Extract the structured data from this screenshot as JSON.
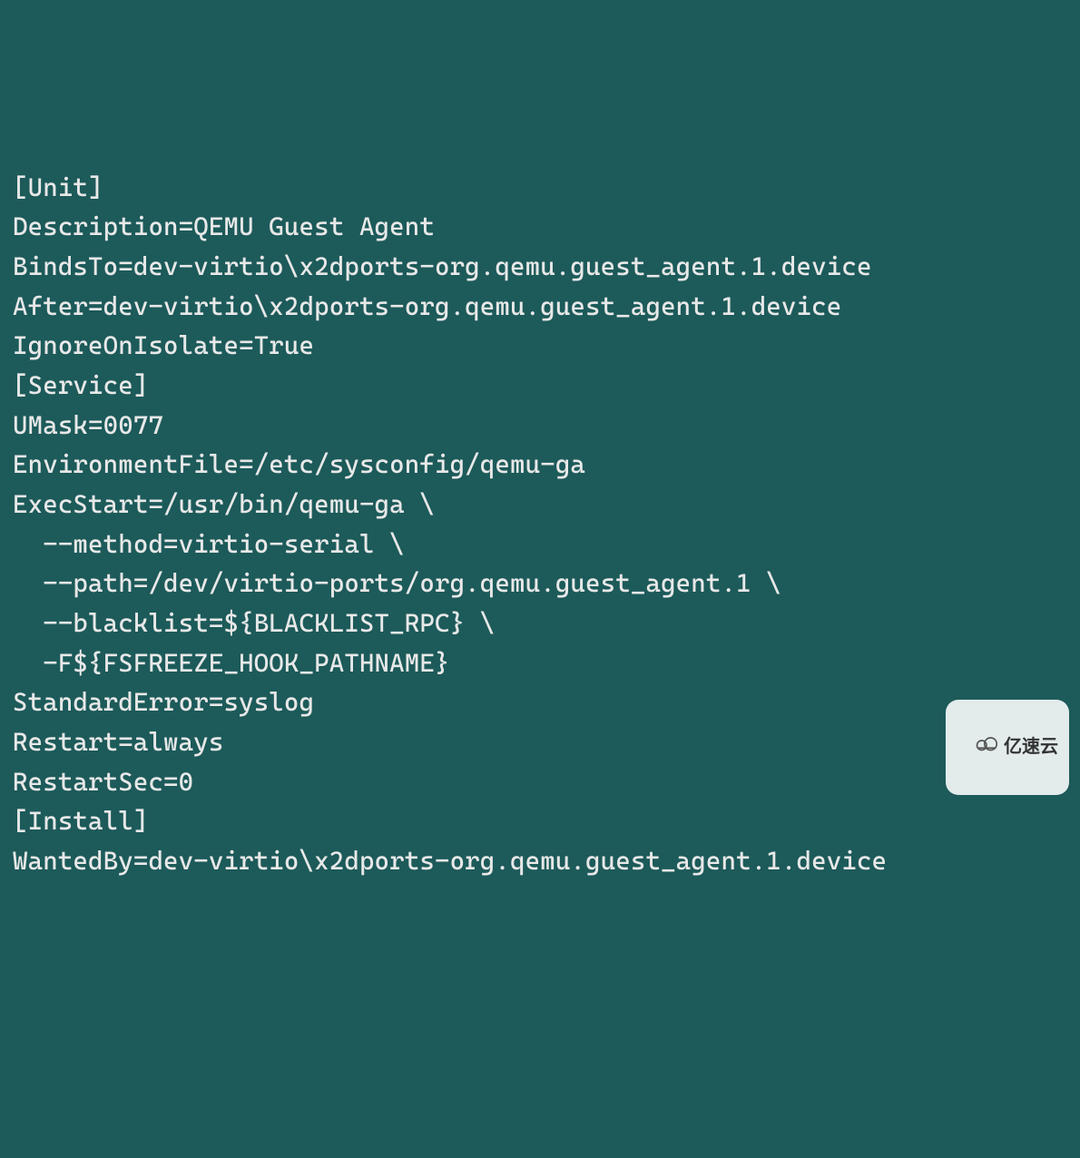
{
  "config": {
    "lines": [
      "[Unit]",
      "Description=QEMU Guest Agent",
      "BindsTo=dev-virtio\\x2dports-org.qemu.guest_agent.1.device",
      "After=dev-virtio\\x2dports-org.qemu.guest_agent.1.device",
      "IgnoreOnIsolate=True",
      "",
      "[Service]",
      "UMask=0077",
      "EnvironmentFile=/etc/sysconfig/qemu-ga",
      "ExecStart=/usr/bin/qemu-ga \\",
      "  --method=virtio-serial \\",
      "  --path=/dev/virtio-ports/org.qemu.guest_agent.1 \\",
      "  --blacklist=${BLACKLIST_RPC} \\",
      "  -F${FSFREEZE_HOOK_PATHNAME}",
      "StandardError=syslog",
      "Restart=always",
      "RestartSec=0",
      "",
      "[Install]",
      "WantedBy=dev-virtio\\x2dports-org.qemu.guest_agent.1.device"
    ]
  },
  "watermark": {
    "text": "亿速云"
  }
}
